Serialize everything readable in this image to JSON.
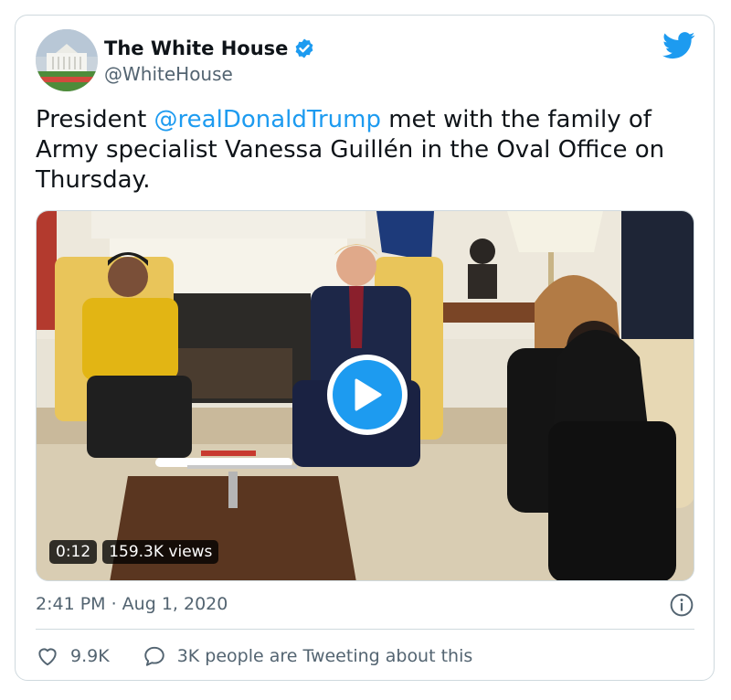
{
  "author": {
    "display_name": "The White House",
    "handle": "@WhiteHouse"
  },
  "tweet": {
    "text_before": "President ",
    "mention": "@realDonaldTrump",
    "text_after": " met with the family of Army specialist Vanessa Guillén in the Oval Office on Thursday."
  },
  "video": {
    "duration": "0:12",
    "views": "159.3K views"
  },
  "meta": {
    "timestamp": "2:41 PM · Aug 1, 2020"
  },
  "actions": {
    "likes": "9.9K",
    "conversation": "3K people are Tweeting about this"
  },
  "colors": {
    "accent": "#1d9bf0",
    "secondary_text": "#536471",
    "border": "#cfd9de"
  },
  "icons": {
    "verified": "verified-badge-icon",
    "brand": "twitter-bird-icon",
    "play": "play-icon",
    "info": "info-icon",
    "like": "heart-icon",
    "reply": "speech-bubble-icon"
  }
}
